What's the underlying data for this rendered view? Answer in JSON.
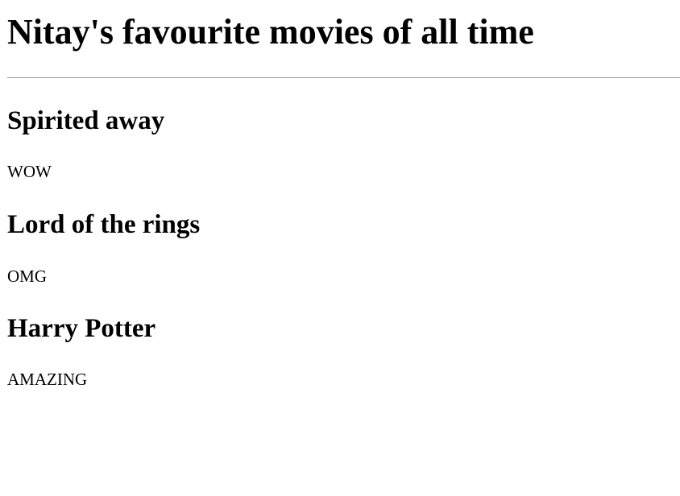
{
  "page": {
    "title": "Nitay's favourite movies of all time"
  },
  "movies": [
    {
      "title": "Spirited away",
      "comment": "WOW"
    },
    {
      "title": "Lord of the rings",
      "comment": "OMG"
    },
    {
      "title": "Harry Potter",
      "comment": "AMAZING"
    }
  ],
  "colors": {
    "background": "#ffffff",
    "text": "#000000",
    "divider": "#9a9a9a"
  }
}
